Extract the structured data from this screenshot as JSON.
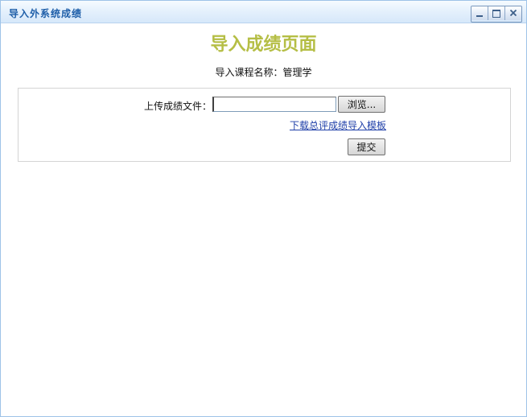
{
  "window": {
    "title": "导入外系统成绩"
  },
  "page": {
    "heading": "导入成绩页面",
    "course_line": "导入课程名称：管理学"
  },
  "upload_form": {
    "file_label": "上传成绩文件：",
    "file_value": "",
    "browse_label": "浏览...",
    "template_link": "下载总评成绩导入模板",
    "submit_label": "提交"
  },
  "colors": {
    "heading": "#b5be45",
    "title_text": "#1f5fa9",
    "link": "#1f3fa8",
    "window_border": "#9ec3e8"
  },
  "icons": {
    "minimize": "minimize-icon",
    "maximize": "maximize-icon",
    "close": "close-icon"
  }
}
